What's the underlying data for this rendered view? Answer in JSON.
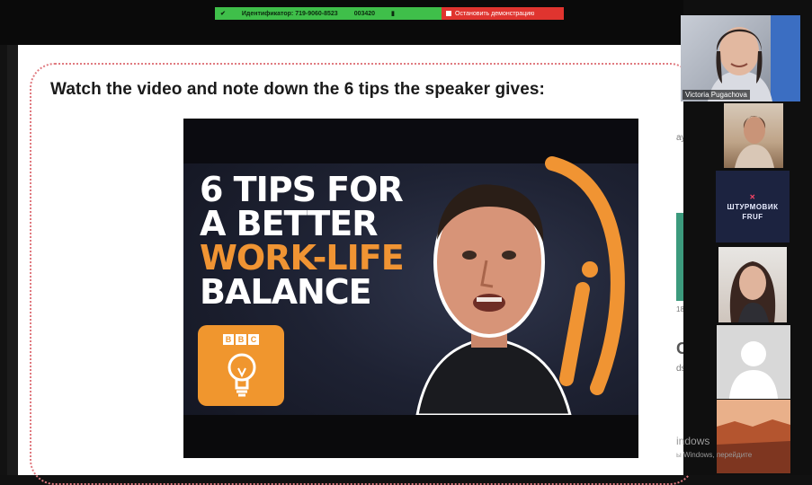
{
  "share_bar": {
    "id_label": "Идентификатор: 719-9060-8523",
    "timer": "003420",
    "stop_label": "Остановить демонстрацию"
  },
  "slide": {
    "heading": "Watch the video and note down the 6 tips the speaker gives:",
    "video": {
      "title_line1": "6 TIPS FOR",
      "title_line2": "A BETTER",
      "title_line3": "WORK-LIFE",
      "title_line4": "BALANCE",
      "brand": [
        "B",
        "B",
        "C"
      ]
    }
  },
  "participants": {
    "main_name": "Victoria Pugachova",
    "tile3_line1": "ШТУРМОВИК",
    "tile3_line2": "FRUF"
  },
  "background_fragments": {
    "frag1": "ay",
    "frag2": "18",
    "frag3": "ON",
    "frag4": "ds",
    "watermark_big": "indows",
    "watermark_small": "ы Windows, перейдите"
  },
  "colors": {
    "share_green": "#3fbf4a",
    "share_red": "#e0342f",
    "accent_orange": "#f09433",
    "dotted_border": "#e07a80"
  }
}
